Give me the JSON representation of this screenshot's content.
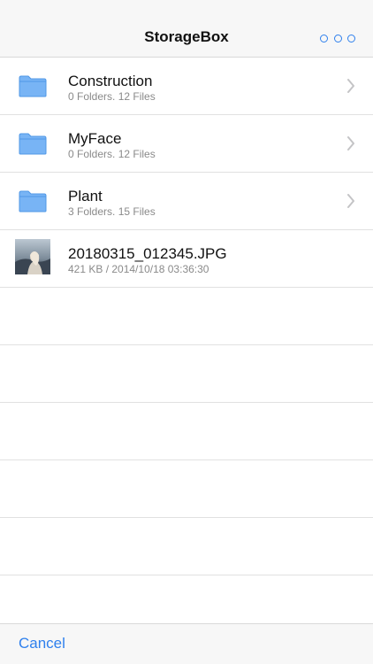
{
  "navbar": {
    "title": "StorageBox",
    "more_icon": "more-horizontal-icon",
    "accent_color": "#2f80ed"
  },
  "items": [
    {
      "name": "Construction",
      "meta": "0 Folders. 12 Files",
      "icon": "folder-icon"
    },
    {
      "name": "MyFace",
      "meta": "0 Folders. 12 Files",
      "icon": "folder-icon"
    },
    {
      "name": "Plant",
      "meta": "3 Folders. 15 Files",
      "icon": "folder-icon"
    }
  ],
  "file": {
    "name": "20180315_012345.JPG",
    "meta": "421 KB / 2014/10/18 03:36:30",
    "icon": "image-thumbnail"
  },
  "colors": {
    "folder": "#78b4f5",
    "separator": "#e1e1e1",
    "secondary_text": "#8a8a8a"
  },
  "footer": {
    "cancel_label": "Cancel"
  }
}
